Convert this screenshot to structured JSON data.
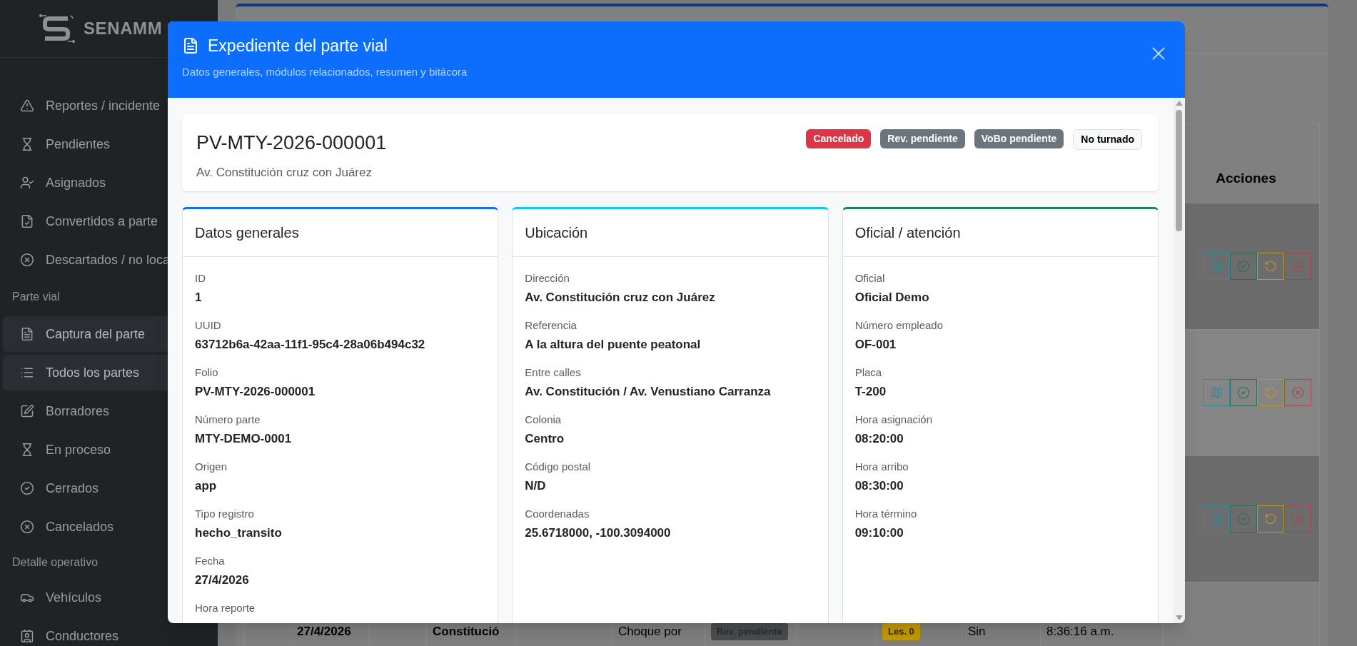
{
  "sidebar": {
    "brand": "SENAMM",
    "nav": [
      {
        "kind": "item",
        "label": "Reportes / incidente",
        "selected": false
      },
      {
        "kind": "item",
        "label": "Pendientes",
        "selected": false
      },
      {
        "kind": "item",
        "label": "Asignados",
        "selected": false
      },
      {
        "kind": "item",
        "label": "Convertidos a parte",
        "selected": false
      },
      {
        "kind": "item",
        "label": "Descartados / no loca",
        "selected": false
      },
      {
        "kind": "section",
        "label": "Parte vial"
      },
      {
        "kind": "item",
        "label": "Captura del parte",
        "selected": true
      },
      {
        "kind": "item",
        "label": "Todos los partes",
        "selected": true
      },
      {
        "kind": "item",
        "label": "Borradores",
        "selected": false
      },
      {
        "kind": "item",
        "label": "En proceso",
        "selected": false
      },
      {
        "kind": "item",
        "label": "Cerrados",
        "selected": false
      },
      {
        "kind": "item",
        "label": "Cancelados",
        "selected": false
      },
      {
        "kind": "section",
        "label": "Detalle operativo"
      },
      {
        "kind": "item",
        "label": "Vehículos",
        "selected": false
      },
      {
        "kind": "item",
        "label": "Conductores",
        "selected": false
      }
    ]
  },
  "table": {
    "actions_heading": "Acciones",
    "rows": [
      {
        "striped": true
      },
      {
        "striped": false
      },
      {
        "striped": true
      }
    ],
    "last_row": [
      {
        "kind": "empty"
      },
      {
        "kind": "bold",
        "text": "27/4/2026"
      },
      {
        "kind": "empty"
      },
      {
        "kind": "bold",
        "text": "Constitució"
      },
      {
        "kind": "empty"
      },
      {
        "kind": "text",
        "text": "Choque por"
      },
      {
        "kind": "badge",
        "text": "Rev. pendiente",
        "color": "#4a4d50"
      },
      {
        "kind": "empty"
      },
      {
        "kind": "badge",
        "text": "Les. 0",
        "color": "#c79a00"
      },
      {
        "kind": "text",
        "text": "Sin"
      },
      {
        "kind": "text",
        "text": "8:36:16 a.m."
      }
    ]
  },
  "modal": {
    "title": "Expediente del parte vial",
    "subtitle": "Datos generales, módulos relacionados, resumen y bitácora",
    "summary": {
      "folio": "PV-MTY-2026-000001",
      "address": "Av. Constitución cruz con Juárez",
      "badges": [
        {
          "text": "Cancelado",
          "color": "#dc3545"
        },
        {
          "text": "Rev. pendiente",
          "color": "#6c757d"
        },
        {
          "text": "VoBo pendiente",
          "color": "#6c757d"
        },
        {
          "text": "No turnado",
          "color": "#f8f9fa"
        }
      ]
    },
    "cards": [
      {
        "title": "Datos generales",
        "color": "#0d6efd",
        "fields": [
          {
            "label": "ID",
            "value": "1"
          },
          {
            "label": "UUID",
            "value": "63712b6a-42aa-11f1-95c4-28a06b494c32"
          },
          {
            "label": "Folio",
            "value": "PV-MTY-2026-000001"
          },
          {
            "label": "Número parte",
            "value": "MTY-DEMO-0001"
          },
          {
            "label": "Origen",
            "value": "app"
          },
          {
            "label": "Tipo registro",
            "value": "hecho_transito"
          },
          {
            "label": "Fecha",
            "value": "27/4/2026"
          },
          {
            "label": "Hora reporte"
          }
        ]
      },
      {
        "title": "Ubicación",
        "color": "#0dcaf0",
        "fields": [
          {
            "label": "Dirección",
            "value": "Av. Constitución cruz con Juárez"
          },
          {
            "label": "Referencia",
            "value": "A la altura del puente peatonal"
          },
          {
            "label": "Entre calles",
            "value": "Av. Constitución / Av. Venustiano Carranza"
          },
          {
            "label": "Colonia",
            "value": "Centro"
          },
          {
            "label": "Código postal",
            "value": "N/D"
          },
          {
            "label": "Coordenadas",
            "value": "25.6718000, -100.3094000"
          }
        ]
      },
      {
        "title": "Oficial / atención",
        "color": "#198754",
        "fields": [
          {
            "label": "Oficial",
            "value": "Oficial Demo"
          },
          {
            "label": "Número empleado",
            "value": "OF-001"
          },
          {
            "label": "Placa",
            "value": "T-200"
          },
          {
            "label": "Hora asignación",
            "value": "08:20:00"
          },
          {
            "label": "Hora arribo",
            "value": "08:30:00"
          },
          {
            "label": "Hora término",
            "value": "09:10:00"
          }
        ]
      }
    ]
  }
}
